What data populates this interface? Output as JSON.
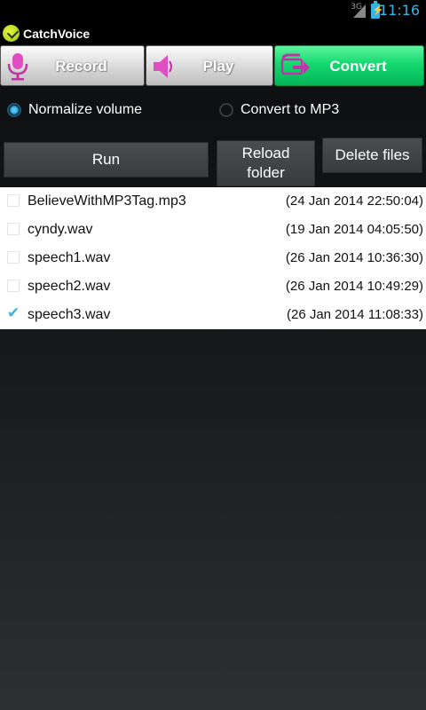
{
  "status_bar": {
    "network": "3G",
    "time": "11:16",
    "accent_color": "#33b5e5"
  },
  "app": {
    "title": "CatchVoice",
    "icon": "catchvoice-logo-icon"
  },
  "tabs": [
    {
      "label": "Record",
      "icon": "microphone-icon",
      "active": false
    },
    {
      "label": "Play",
      "icon": "speaker-icon",
      "active": false
    },
    {
      "label": "Convert",
      "icon": "convert-arrow-icon",
      "active": true,
      "color": "#15d86f"
    }
  ],
  "options": {
    "normalize": {
      "label": "Normalize volume",
      "selected": true
    },
    "mp3": {
      "label": "Convert to MP3",
      "selected": false
    }
  },
  "buttons": {
    "run": "Run",
    "reload_line1": "Reload",
    "reload_line2": "folder",
    "delete": "Delete files"
  },
  "files": [
    {
      "name": "BelieveWithMP3Tag.mp3",
      "date": "(24 Jan 2014 22:50:04)",
      "checked": false
    },
    {
      "name": "cyndy.wav",
      "date": "(19 Jan 2014 04:05:50)",
      "checked": false
    },
    {
      "name": "speech1.wav",
      "date": "(26 Jan 2014 10:36:30)",
      "checked": false
    },
    {
      "name": "speech2.wav",
      "date": "(26 Jan 2014 10:49:29)",
      "checked": false
    },
    {
      "name": "speech3.wav",
      "date": "(26 Jan 2014 11:08:33)",
      "checked": true
    }
  ]
}
